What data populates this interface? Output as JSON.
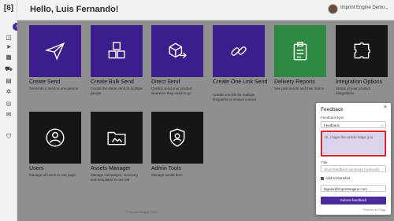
{
  "app": {
    "logo": "[6]"
  },
  "header": {
    "greeting": "Hello, Luis Fernando!",
    "account_name": "Imprint Engine Demo",
    "avatar_icon": "user-avatar"
  },
  "sidebar": {
    "toggle_icon": "chevron-right-icon",
    "items": [
      {
        "icon": "dashboard-icon",
        "glyph": "◫"
      },
      {
        "icon": "send-icon",
        "glyph": "➤"
      },
      {
        "icon": "boxes-icon",
        "glyph": "▦"
      },
      {
        "icon": "truck-icon",
        "glyph": "⛟"
      },
      {
        "icon": "report-icon",
        "glyph": "▤"
      },
      {
        "icon": "settings-icon",
        "glyph": "✲"
      },
      {
        "icon": "globe-icon",
        "glyph": "◎"
      },
      {
        "icon": "mail-icon",
        "glyph": "✉"
      },
      {
        "icon": "shield-icon",
        "glyph": "⛉"
      }
    ]
  },
  "tiles": [
    {
      "title": "Create Send",
      "desc": "Generate a send to one person",
      "icon": "paper-plane-icon",
      "color": "#3b1d8e"
    },
    {
      "title": "Create Bulk Send",
      "desc": "Create the same send to multiple people",
      "icon": "boxes-icon",
      "color": "#3b1d8e"
    },
    {
      "title": "Direct Send",
      "desc": "Quickly send your product wherever they need to go",
      "icon": "box-arrow-icon",
      "color": "#3b1d8e"
    },
    {
      "title": "Create One Link Send",
      "desc": "Create one link for multiple recipients to receive a send",
      "icon": "link-icon",
      "color": "#3b1d8e"
    },
    {
      "title": "Delivery Reports",
      "desc": "See past sends and their status",
      "icon": "clipboard-icon",
      "color": "#2c8a42"
    },
    {
      "title": "Integration Options",
      "desc": "Status of your product integrations",
      "icon": "puzzle-icon",
      "color": "#161616"
    },
    {
      "title": "Users",
      "desc": "Manage all users in one page",
      "icon": "users-icon",
      "color": "#161616"
    },
    {
      "title": "Assets Manager",
      "desc": "Manage campaigns, inventory and templates in one tab",
      "icon": "folder-icon",
      "color": "#161616"
    },
    {
      "title": "Admin Tools",
      "desc": "Manage sends here",
      "icon": "admin-user-icon",
      "color": "#161616"
    }
  ],
  "footer": {
    "text": "© Imprint Engine 2024"
  },
  "feedback": {
    "title": "Feedback",
    "type_label": "Feedback type",
    "type_value": "Feedback",
    "message": "Hi, I hope this article helps you",
    "title_label": "Title",
    "title_placeholder": "Short feedback summary (optional)",
    "screenshot_label": "Add screenshot",
    "email_value": "lagular@imprintengine.com",
    "submit_label": "Submit feedback",
    "powered_by": "Powered by Plugg",
    "accent": "#4b2b9c",
    "highlight": "#e0202a"
  }
}
